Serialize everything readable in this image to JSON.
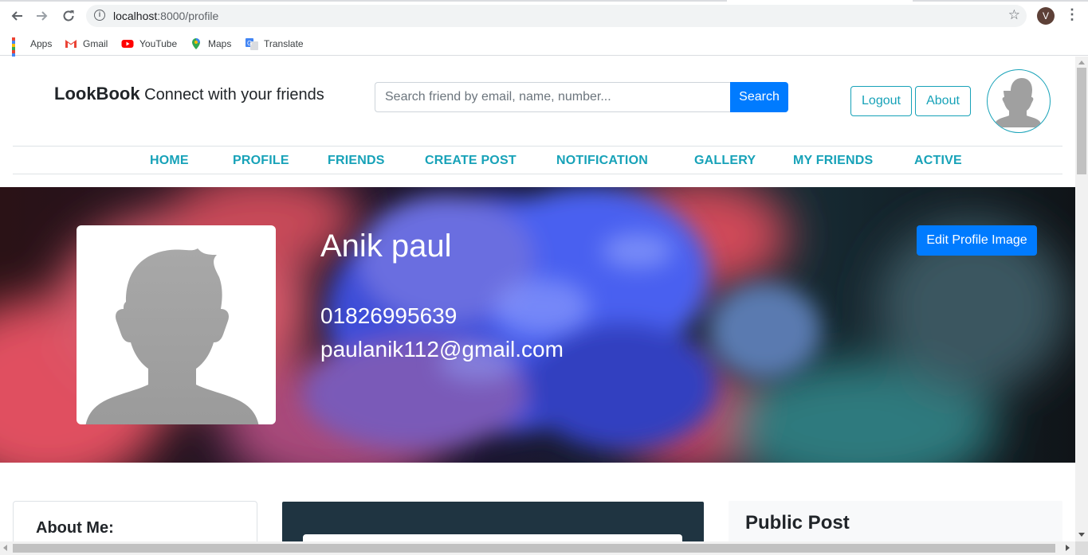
{
  "browser": {
    "url_host": "localhost",
    "url_path": ":8000/profile",
    "user_initial": "V",
    "bookmarks": [
      {
        "label": "Apps",
        "icon": "apps-grid-icon"
      },
      {
        "label": "Gmail",
        "icon": "gmail-icon"
      },
      {
        "label": "YouTube",
        "icon": "youtube-icon"
      },
      {
        "label": "Maps",
        "icon": "maps-pin-icon"
      },
      {
        "label": "Translate",
        "icon": "translate-icon"
      }
    ]
  },
  "header": {
    "brand_name": "LookBook",
    "brand_tagline": "Connect with your friends",
    "search_placeholder": "Search friend by email, name, number...",
    "search_label": "Search",
    "logout_label": "Logout",
    "about_label": "About"
  },
  "nav": {
    "items": [
      "HOME",
      "PROFILE",
      "FRIENDS",
      "CREATE POST",
      "NOTIFICATION",
      "GALLERY",
      "MY FRIENDS",
      "ACTIVE"
    ]
  },
  "profile": {
    "name": "Anik paul",
    "phone": "01826995639",
    "email": "paulanik112@gmail.com",
    "edit_image_label": "Edit Profile Image"
  },
  "sections": {
    "about_title": "About Me:",
    "public_post_title": "Public Post"
  },
  "colors": {
    "primary": "#007bff",
    "info": "#17a2b8",
    "dark_card": "#1f3441"
  }
}
